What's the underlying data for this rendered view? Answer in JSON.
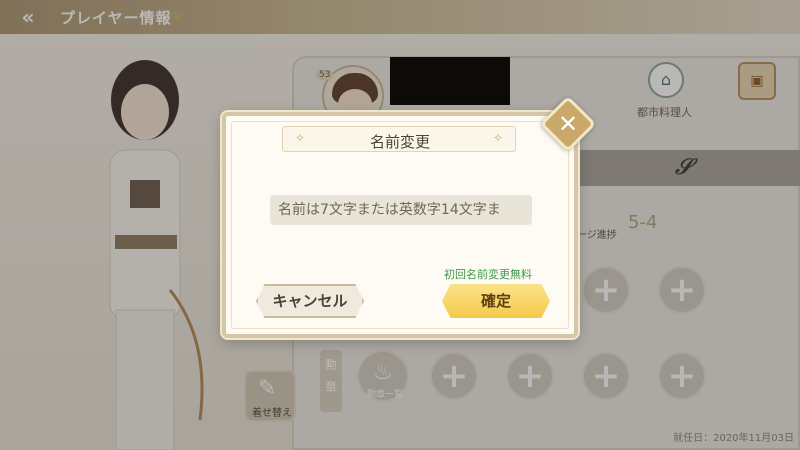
{
  "header": {
    "back_icon": "back-arrow-icon",
    "title": "プレイヤー情報",
    "title_badge_icon": "crown-icon"
  },
  "profile": {
    "level": "53",
    "city_chef_label": "都市料理人",
    "stage_label": "ージ進捗",
    "stage_value": "5-4"
  },
  "medals": {
    "tab_label": "勲章",
    "list_label": "勲章一覧"
  },
  "side_buttons": {
    "outfit_label": "着せ替え"
  },
  "footer": {
    "register_date": "就任日：2020年11月03日"
  },
  "dialog": {
    "title": "名前変更",
    "input_placeholder": "名前は7文字または英数字14文字ま",
    "free_note": "初回名前変更無料",
    "cancel_label": "キャンセル",
    "confirm_label": "確定",
    "close_icon": "close-icon"
  },
  "colors": {
    "accent_gold": "#f4c94a",
    "frame": "#d6c7a4",
    "free_note_green": "#3f9a4c"
  }
}
